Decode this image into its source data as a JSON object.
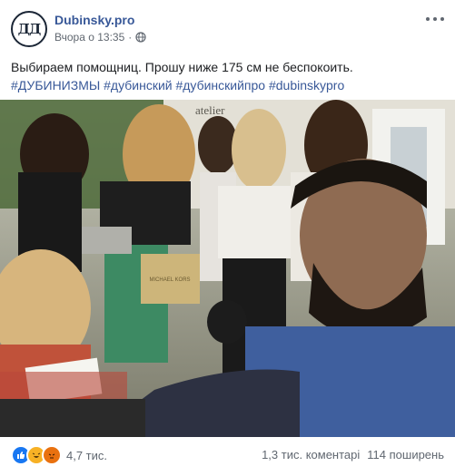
{
  "post": {
    "author": "Dubinsky.pro",
    "avatar_initials": "ДД",
    "timestamp": "Вчора о 13:35",
    "separator": "·",
    "privacy_icon": "globe-icon",
    "text_line": "Выбираем помощниц. Прошу ниже 175 см не беспокоить.",
    "hashtags": "#ДУБИНИЗМЫ #дубинский #дубинскийпро #dubinskypro",
    "photo_sign_text": "atelier",
    "bag_text": "MICHAEL KORS"
  },
  "footer": {
    "reaction_icons": [
      "like-icon",
      "haha-icon",
      "angry-icon"
    ],
    "reaction_count": "4,7 тис.",
    "comments": "1,3 тис. коментарі",
    "shares": "114 поширень"
  },
  "colors": {
    "link": "#385898",
    "meta": "#606770",
    "like": "#1877f2",
    "haha": "#f7b125",
    "angry": "#e9710f"
  }
}
